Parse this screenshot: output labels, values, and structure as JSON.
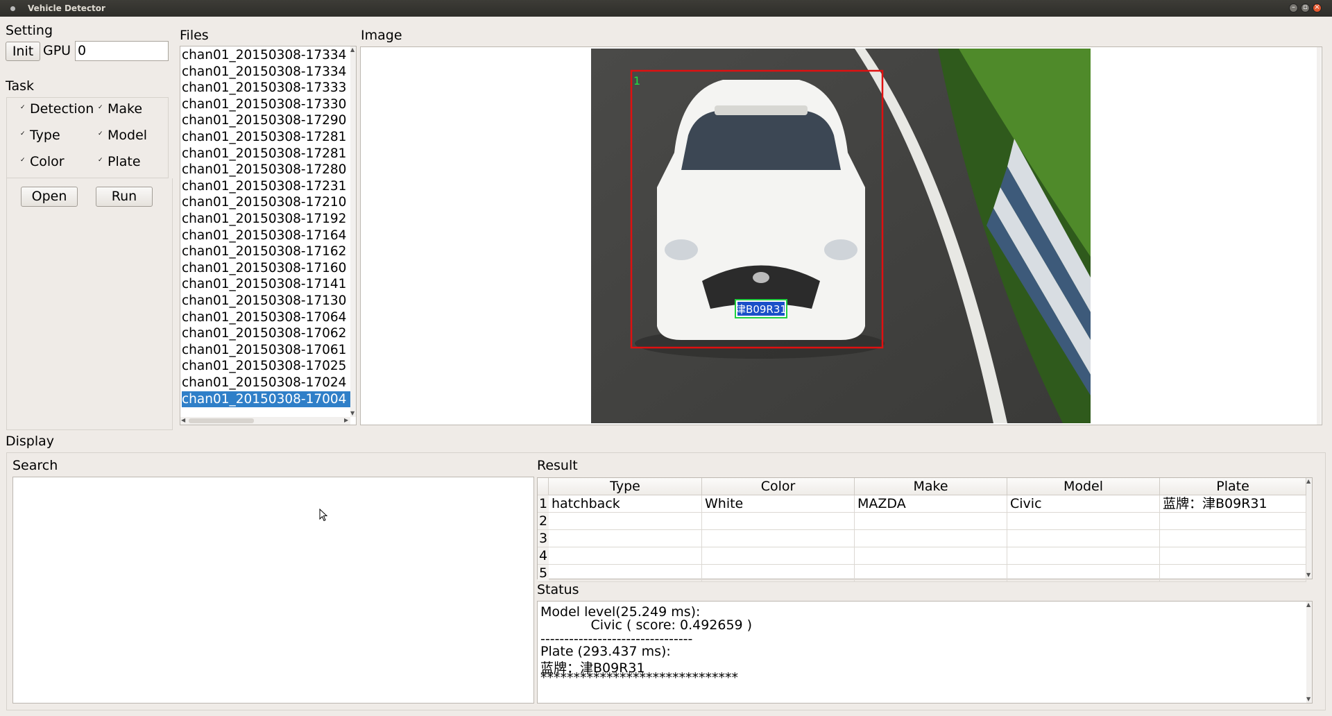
{
  "window": {
    "title": "Vehicle Detector"
  },
  "setting": {
    "section_label": "Setting",
    "init_button": "Init",
    "gpu_label": "GPU",
    "gpu_value": "0"
  },
  "task": {
    "section_label": "Task",
    "options": [
      {
        "label": "Detection",
        "checked": true
      },
      {
        "label": "Make",
        "checked": true
      },
      {
        "label": "Type",
        "checked": true
      },
      {
        "label": "Model",
        "checked": true
      },
      {
        "label": "Color",
        "checked": true
      },
      {
        "label": "Plate",
        "checked": true
      }
    ],
    "open_button": "Open",
    "run_button": "Run"
  },
  "files": {
    "section_label": "Files",
    "selected_index": 21,
    "items": [
      "chan01_20150308-17334",
      "chan01_20150308-17334",
      "chan01_20150308-17333",
      "chan01_20150308-17330",
      "chan01_20150308-17290",
      "chan01_20150308-17281",
      "chan01_20150308-17281",
      "chan01_20150308-17280",
      "chan01_20150308-17231",
      "chan01_20150308-17210",
      "chan01_20150308-17192",
      "chan01_20150308-17164",
      "chan01_20150308-17162",
      "chan01_20150308-17160",
      "chan01_20150308-17141",
      "chan01_20150308-17130",
      "chan01_20150308-17064",
      "chan01_20150308-17062",
      "chan01_20150308-17061",
      "chan01_20150308-17025",
      "chan01_20150308-17024",
      "chan01_20150308-17004"
    ]
  },
  "image": {
    "section_label": "Image",
    "detection_index_label": "1",
    "plate_text": "津B09R31",
    "box_color": "#e01010",
    "plate_box_color": "#20d040"
  },
  "display": {
    "section_label": "Display",
    "search_label": "Search",
    "result_label": "Result",
    "status_label": "Status"
  },
  "result_table": {
    "columns": [
      "Type",
      "Color",
      "Make",
      "Model",
      "Plate"
    ],
    "rows": [
      {
        "index": "1",
        "cells": [
          "hatchback",
          "White",
          "MAZDA",
          "Civic",
          "蓝牌：津B09R31"
        ]
      },
      {
        "index": "2",
        "cells": [
          "",
          "",
          "",
          "",
          ""
        ]
      },
      {
        "index": "3",
        "cells": [
          "",
          "",
          "",
          "",
          ""
        ]
      },
      {
        "index": "4",
        "cells": [
          "",
          "",
          "",
          "",
          ""
        ]
      },
      {
        "index": "5",
        "cells": [
          "",
          "",
          "",
          "",
          ""
        ]
      }
    ]
  },
  "status": {
    "lines": [
      "Model level(25.249 ms):",
      "            Civic ( score: 0.492659 )",
      "--------------------------------",
      "Plate (293.437 ms):",
      "蓝牌：津B09R31",
      "******************************"
    ]
  },
  "colors": {
    "selection": "#2f7fc8",
    "titlebar": "#3a3934",
    "window_bg": "#efebe7"
  }
}
